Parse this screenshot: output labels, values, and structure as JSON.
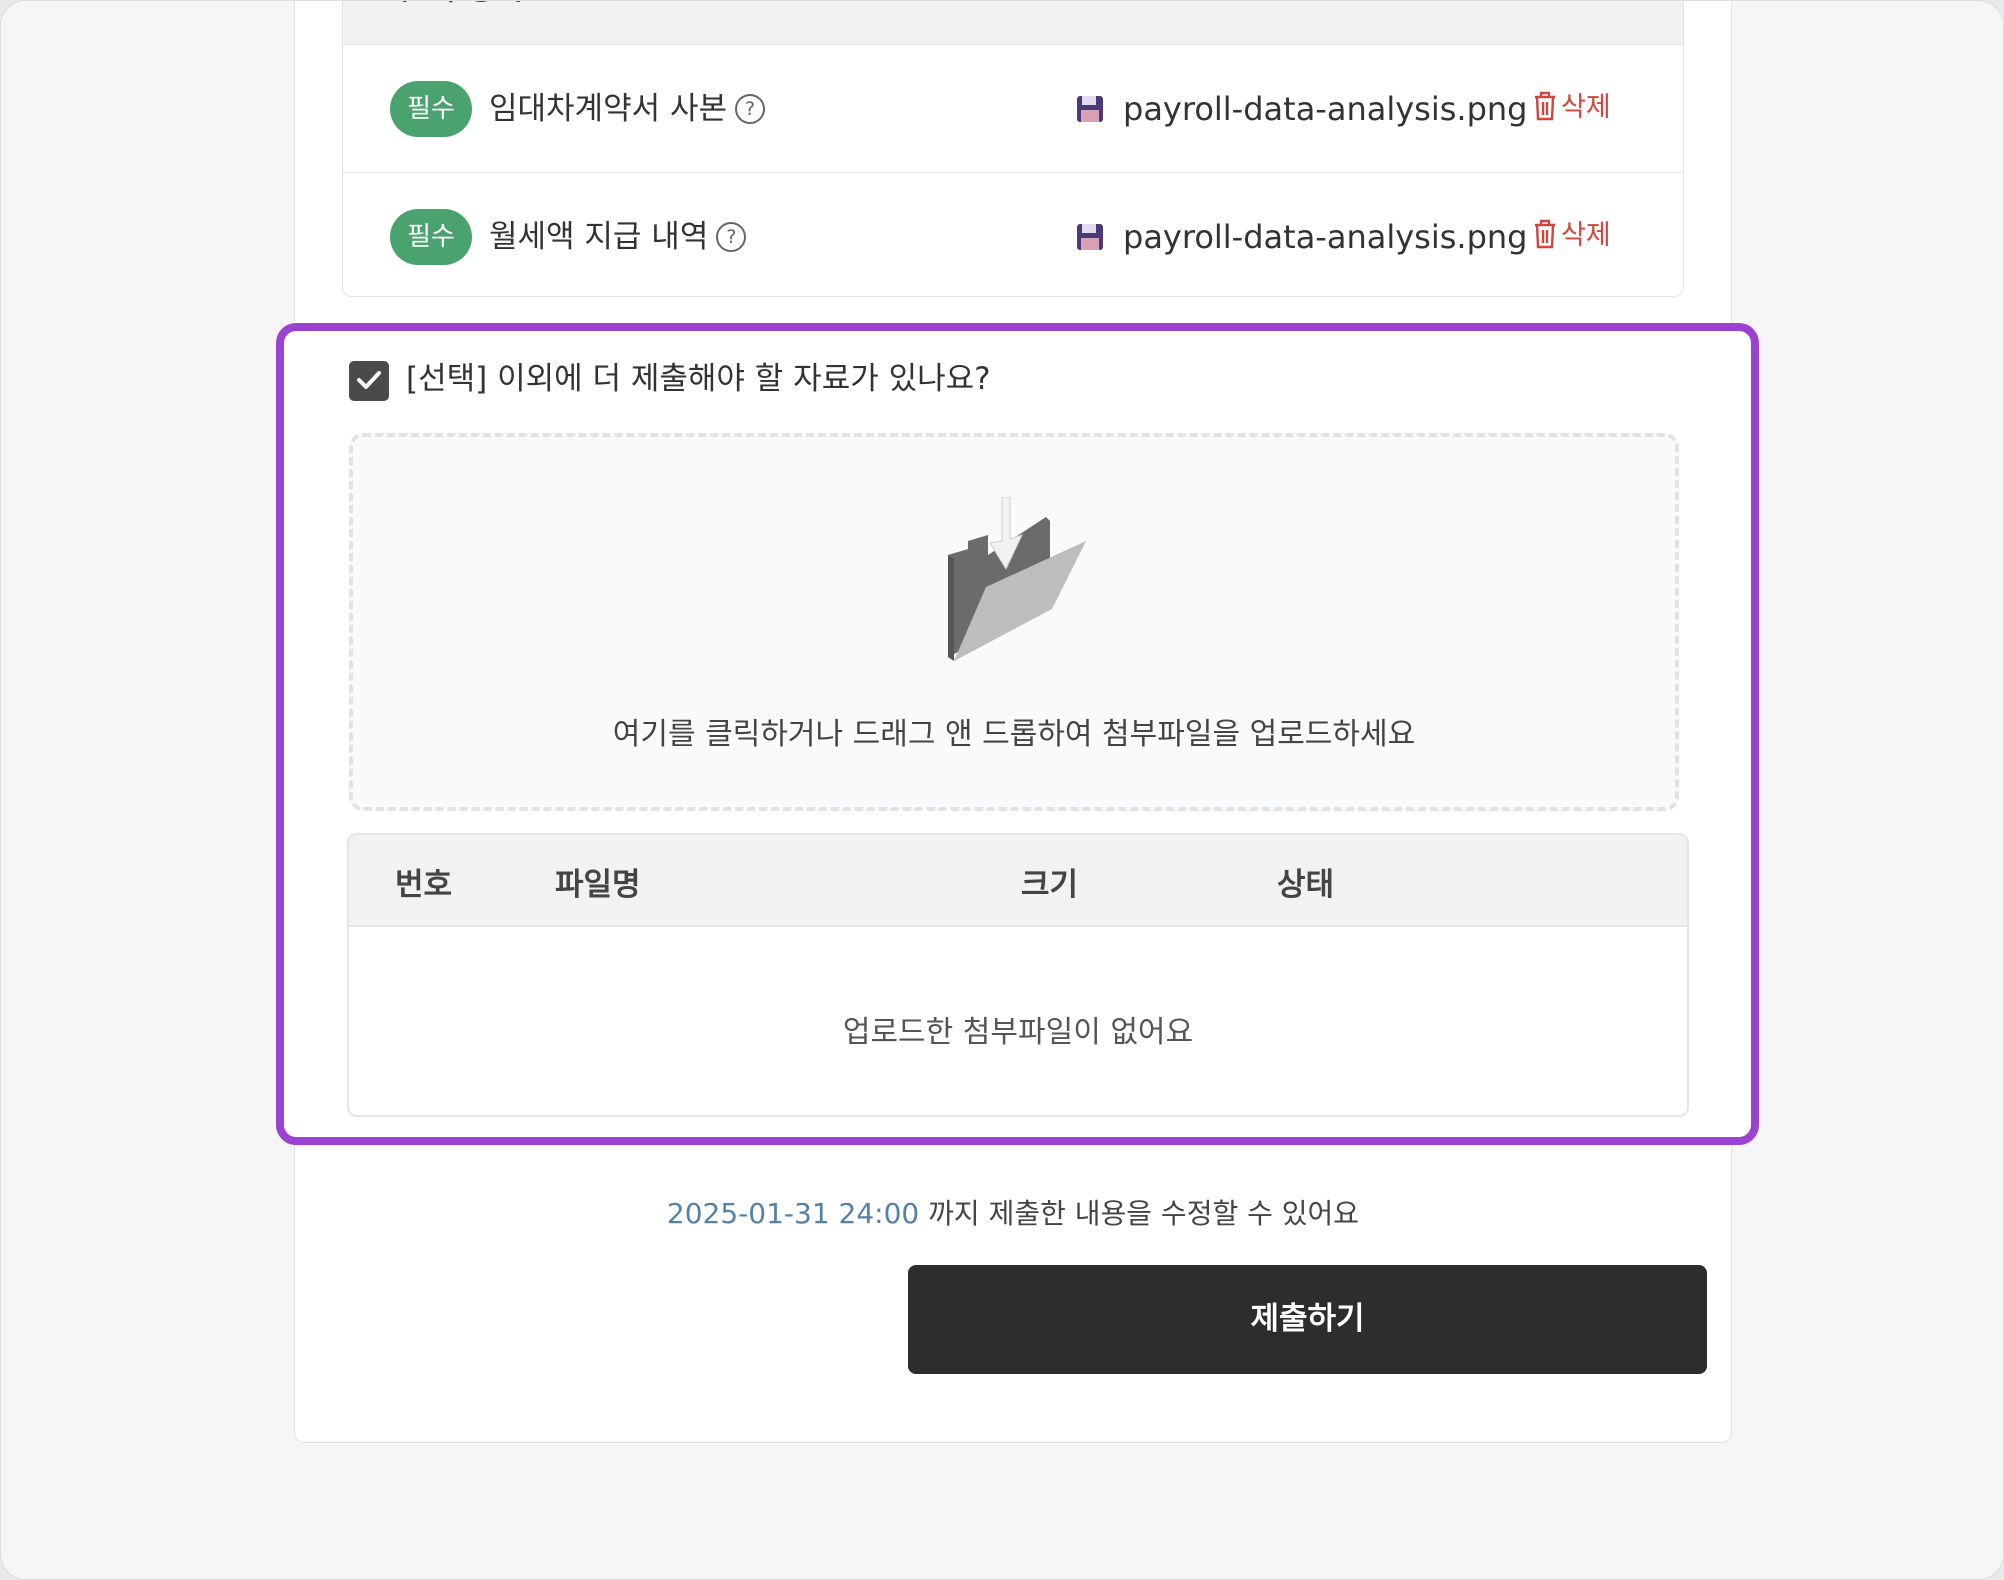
{
  "required_docs": {
    "header_label": "구 독 상세",
    "items": [
      {
        "badge": "필수",
        "name": "임대차계약서 사본",
        "help_icon": "question-circle-icon",
        "file_icon": "floppy-disk-icon",
        "file_name": "payroll-data-analysis.png",
        "delete_label": "삭제"
      },
      {
        "badge": "필수",
        "name": "월세액 지급 내역",
        "help_icon": "question-circle-icon",
        "file_icon": "floppy-disk-icon",
        "file_name": "payroll-data-analysis.png",
        "delete_label": "삭제"
      }
    ]
  },
  "optional_section": {
    "checked": true,
    "checkbox_label": "[선택] 이외에 더 제출해야 할 자료가 있나요?",
    "dropzone_icon": "folder-download-icon",
    "dropzone_text": "여기를 클릭하거나 드래그 앤 드롭하여 첨부파일을 업로드하세요",
    "table": {
      "columns": [
        "번호",
        "파일명",
        "크기",
        "상태"
      ],
      "empty_text": "업로드한 첨부파일이 없어요"
    },
    "highlight_color": "#9b42d0"
  },
  "footer": {
    "deadline_date": "2025-01-31 24:00",
    "deadline_text": " 까지 제출한 내용을 수정할 수 있어요",
    "submit_label": "제출하기"
  },
  "colors": {
    "badge": "#4aa36e",
    "delete": "#d0463f",
    "date": "#5381a8",
    "submit": "#2d2d2d"
  }
}
